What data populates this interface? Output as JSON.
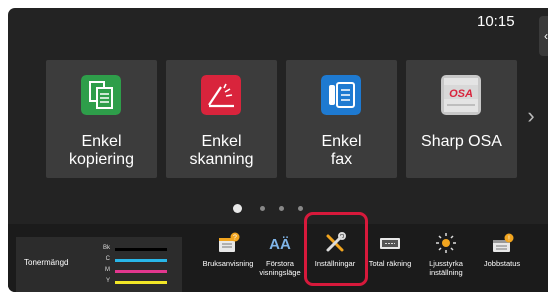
{
  "status": {
    "time": "10:15"
  },
  "side_tab": {
    "icon": "chevron-left-icon",
    "glyph": "‹"
  },
  "tiles": [
    {
      "label": "Enkel\nkopiering",
      "icon": "copy-icon",
      "color": "#2e9e4a"
    },
    {
      "label": "Enkel\nskanning",
      "icon": "scan-icon",
      "color": "#d9243c"
    },
    {
      "label": "Enkel\nfax",
      "icon": "fax-icon",
      "color": "#1e7ad1"
    },
    {
      "label": "Sharp OSA",
      "icon": "sharp-osa-icon",
      "color": "#c8c8c8",
      "logo_text": "OSA"
    }
  ],
  "pager": {
    "next_glyph": "›",
    "pages": 4,
    "active_page": 1
  },
  "toner": {
    "label": "Tonermängd",
    "channels": [
      {
        "key": "Bk",
        "color": "#000000"
      },
      {
        "key": "C",
        "color": "#29b6e8"
      },
      {
        "key": "M",
        "color": "#e2378f"
      },
      {
        "key": "Y",
        "color": "#f2e627"
      }
    ]
  },
  "functions": [
    {
      "label": "Bruksanvisning",
      "icon": "manual-icon"
    },
    {
      "label": "Förstora\nvisningsläge",
      "icon": "enlarge-text-icon",
      "glyph": "AÄ"
    },
    {
      "label": "Inställningar",
      "icon": "settings-tools-icon"
    },
    {
      "label": "Total räkning",
      "icon": "counter-icon"
    },
    {
      "label": "Ljusstyrka\ninställning",
      "icon": "brightness-icon"
    },
    {
      "label": "Jobbstatus",
      "icon": "job-status-icon"
    }
  ]
}
